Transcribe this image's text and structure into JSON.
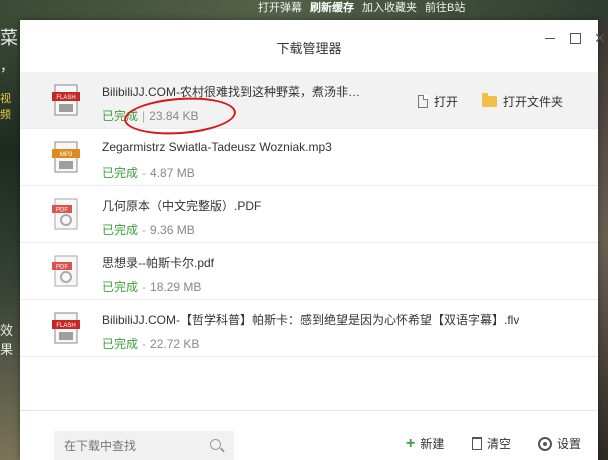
{
  "background": {
    "links": [
      "打开弹幕",
      "刷新缓存",
      "加入收藏夹",
      "前往B站"
    ],
    "left_text": [
      "菜",
      "，",
      "视频",
      "效果"
    ]
  },
  "window": {
    "title": "下载管理器",
    "minimize": "—",
    "maximize": "□",
    "close": "✕"
  },
  "downloads": [
    {
      "icon": "flash-file-icon",
      "icon_label": "FLASH",
      "name": "BilibiliJJ.COM-农村很难找到这种野菜，煮汤非常清甜...",
      "status": "已完成",
      "size": "23.84 KB",
      "actions": {
        "open": "打开",
        "open_folder": "打开文件夹"
      }
    },
    {
      "icon": "mp3-file-icon",
      "icon_label": "MP3",
      "name": "Zegarmistrz Swiatla-Tadeusz Wozniak.mp3",
      "status": "已完成",
      "size": "4.87 MB"
    },
    {
      "icon": "pdf-file-icon",
      "icon_label": "PDF",
      "name": "几何原本（中文完整版）.PDF",
      "status": "已完成",
      "size": "9.36 MB"
    },
    {
      "icon": "pdf-file-icon",
      "icon_label": "PDF",
      "name": "思想录--帕斯卡尔.pdf",
      "status": "已完成",
      "size": "18.29 MB"
    },
    {
      "icon": "flash-file-icon",
      "icon_label": "FLASH",
      "name": "BilibiliJJ.COM-【哲学科普】帕斯卡：感到绝望是因为心怀希望【双语字幕】.flv",
      "status": "已完成",
      "size": "22.72 KB"
    }
  ],
  "footer": {
    "search_placeholder": "在下载中查找",
    "new_label": "新建",
    "clear_label": "清空",
    "settings_label": "设置"
  },
  "colors": {
    "status_done": "#3e9f3a",
    "annotation": "#d8151b",
    "flash_icon": "#c62828",
    "mp3_icon": "#e08a1e",
    "pdf_icon": "#d9534f"
  }
}
